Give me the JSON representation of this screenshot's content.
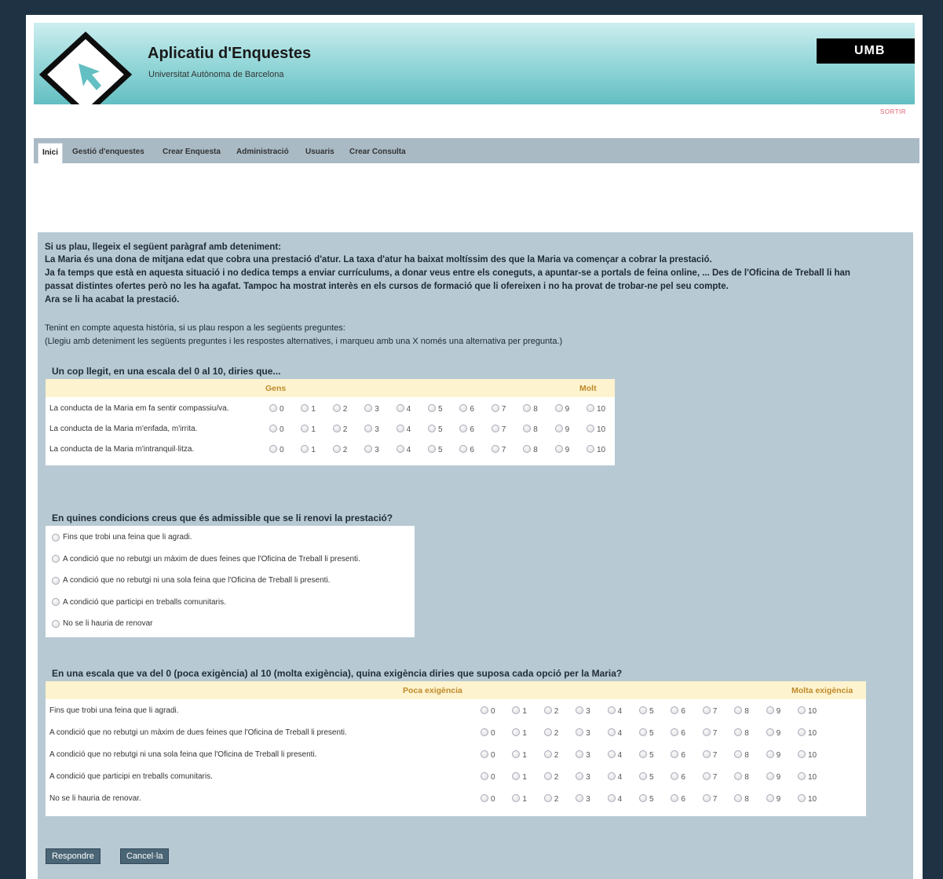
{
  "header": {
    "title": "Aplicatiu d'Enquestes",
    "subtitle": "Universitat Autònoma de Barcelona",
    "brand": "UMB",
    "logout": "SORTIR"
  },
  "nav": {
    "tabs": [
      "Inici",
      "Gestió d'enquestes",
      "Crear Enquesta",
      "Administració",
      "Usuaris",
      "Crear Consulta"
    ],
    "active": "Inici"
  },
  "intro": {
    "heading": "Si us plau, llegeix el següent paràgraf amb deteniment:",
    "story1": "La Maria és una dona de mitjana edat que cobra una prestació d'atur. La taxa d'atur ha baixat moltíssim des que la Maria va començar a cobrar la prestació.",
    "story2": "Ja fa temps que està en aquesta situació i no dedica temps a enviar currículums, a donar veus entre els coneguts, a apuntar-se a portals de feina online, ... Des de l'Oficina de Treball li han",
    "story3": "passat distintes ofertes però no les ha agafat. Tampoc ha mostrat interès en els cursos de formació que li ofereixen i no ha provat de trobar-ne pel seu compte.",
    "story4": "Ara se li ha acabat la prestació.",
    "instr1": "Tenint en compte aquesta història, si us plau respon a les següents preguntes:",
    "instr2": "(Llegiu amb deteniment les següents preguntes i les respostes alternatives, i marqueu amb una X només una alternativa per pregunta.)"
  },
  "q1": {
    "title": "Un cop llegit, en una escala del 0 al 10, diries que...",
    "low": "Gens",
    "high": "Molt",
    "rows": [
      "La conducta de la Maria em fa sentir compassiu/va.",
      "La conducta de la Maria m'enfada, m'irrita.",
      "La conducta de la Maria m'intranquil·litza."
    ]
  },
  "scale": [
    "0",
    "1",
    "2",
    "3",
    "4",
    "5",
    "6",
    "7",
    "8",
    "9",
    "10"
  ],
  "q2": {
    "title": "En quines condicions creus que és admissible que se li renovi la prestació?",
    "options": [
      "Fins que trobi una feina que li agradi.",
      "A condició que no rebutgi un màxim de dues feines que l'Oficina de Treball li presenti.",
      "A condició que no rebutgi ni una sola feina que l'Oficina de Treball li presenti.",
      "A condició que participi en treballs comunitaris.",
      "No se li hauria de renovar"
    ]
  },
  "q3": {
    "title": "En una escala que va del 0 (poca exigència) al 10 (molta exigència), quina exigència diries que suposa cada opció per la Maria?",
    "low": "Poca exigència",
    "high": "Molta exigència",
    "rows": [
      "Fins que trobi una feina que li agradi.",
      "A condició que no rebutgi un màxim de dues feines que l'Oficina de Treball li presenti.",
      "A condició que no rebutgi ni una sola feina que l'Oficina de Treball li presenti.",
      "A condició que participi en treballs comunitaris.",
      "No se li hauria de renovar."
    ]
  },
  "buttons": {
    "submit": "Respondre",
    "cancel": "Cancel·la"
  }
}
